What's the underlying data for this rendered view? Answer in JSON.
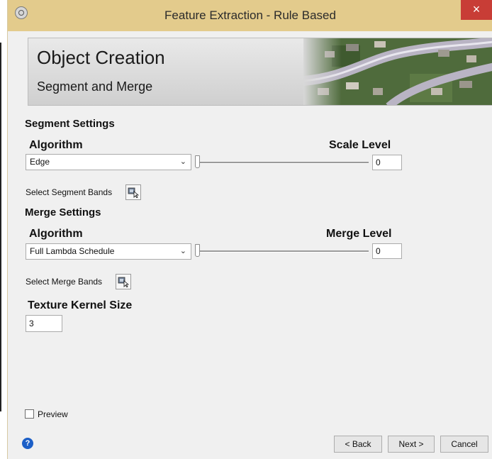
{
  "window": {
    "title": "Feature Extraction - Rule Based",
    "close_symbol": "×"
  },
  "banner": {
    "title": "Object Creation",
    "subtitle": "Segment and Merge",
    "image_name": "aerial-neighborhood-image"
  },
  "segment": {
    "section_title": "Segment Settings",
    "algorithm_label": "Algorithm",
    "algorithm_value": "Edge",
    "level_label": "Scale Level",
    "level_value": "0",
    "bands_label": "Select Segment Bands"
  },
  "merge": {
    "section_title": "Merge Settings",
    "algorithm_label": "Algorithm",
    "algorithm_value": "Full Lambda Schedule",
    "level_label": "Merge Level",
    "level_value": "0",
    "bands_label": "Select Merge Bands"
  },
  "texture": {
    "label": "Texture Kernel Size",
    "value": "3"
  },
  "preview": {
    "label": "Preview",
    "checked": false
  },
  "footer": {
    "help_symbol": "?",
    "back_label": "< Back",
    "next_label": "Next >",
    "cancel_label": "Cancel"
  },
  "icons": {
    "dropdown": "chevron-down-icon",
    "bands": "select-bands-icon",
    "help": "help-icon",
    "app": "app-icon",
    "close": "close-icon"
  },
  "colors": {
    "titlebar": "#e3cb8c",
    "close": "#c83d36",
    "help": "#1c5fc7",
    "dialog_bg": "#f0f0f0"
  }
}
